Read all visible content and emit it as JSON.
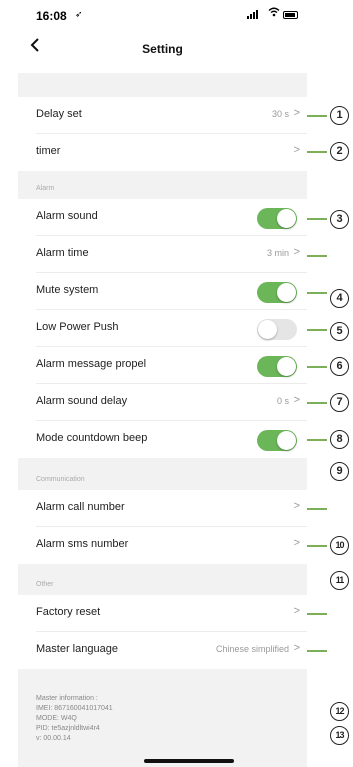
{
  "status_bar": {
    "time": "16:08",
    "location_glyph": "➶"
  },
  "nav": {
    "back_icon": "back-chevron-icon",
    "title": "Setting"
  },
  "rows": {
    "delay_set": {
      "label": "Delay set",
      "value": "30 s",
      "chevron": ">"
    },
    "timer": {
      "label": "timer",
      "chevron": ">"
    },
    "alarm_sound": {
      "label": "Alarm sound",
      "toggle": "on"
    },
    "alarm_time": {
      "label": "Alarm time",
      "value": "3 min",
      "chevron": ">"
    },
    "mute_system": {
      "label": "Mute system",
      "toggle": "on"
    },
    "low_power_push": {
      "label": "Low Power Push",
      "toggle": "off"
    },
    "alarm_message_propel": {
      "label": "Alarm message propel",
      "toggle": "on"
    },
    "alarm_sound_delay": {
      "label": "Alarm sound delay",
      "value": "0 s",
      "chevron": ">"
    },
    "mode_countdown_beep": {
      "label": "Mode countdown beep",
      "toggle": "on"
    },
    "alarm_call_number": {
      "label": "Alarm call number",
      "chevron": ">"
    },
    "alarm_sms_number": {
      "label": "Alarm sms number",
      "chevron": ">"
    },
    "factory_reset": {
      "label": "Factory reset",
      "chevron": ">"
    },
    "master_language": {
      "label": "Master language",
      "value": "Chinese simplified",
      "chevron": ">"
    }
  },
  "sections": {
    "alarm": "Alarm",
    "communication": "Communication",
    "other": "Other"
  },
  "info": {
    "line1": "Master information :",
    "line2": "IMEI: 867160041017041",
    "line3": "MODE: W4Q",
    "line4": "PID: te5azjnldltwi4r4",
    "line5": "v: 00.00.14"
  },
  "markers": {
    "m1": "1",
    "m2": "2",
    "m3": "3",
    "m4": "4",
    "m5": "5",
    "m6": "6",
    "m7": "7",
    "m8": "8",
    "m9": "9",
    "m10": "10",
    "m11": "11",
    "m12": "12",
    "m13": "13"
  },
  "colors": {
    "toggle_on": "#6cb65a",
    "toggle_off": "#e5e5e5",
    "annotation_line": "#7dae58",
    "page_bg": "#f2f2f2"
  }
}
